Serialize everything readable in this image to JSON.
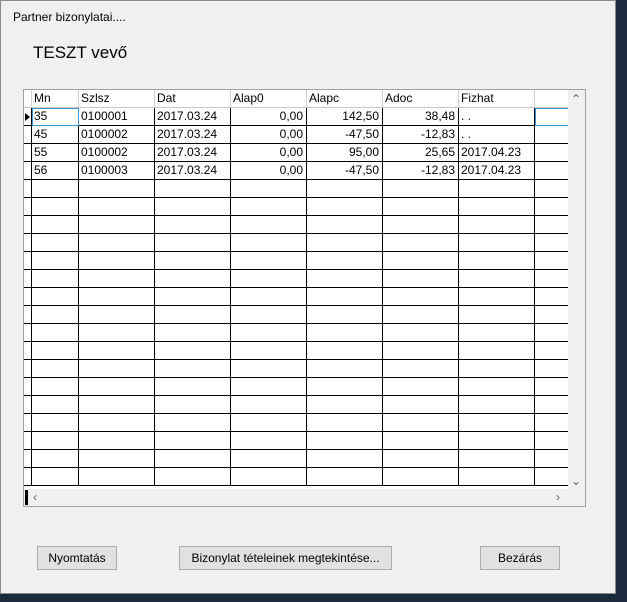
{
  "window": {
    "title": "Partner bizonylatai...."
  },
  "heading": "TESZT vevő",
  "grid": {
    "columns": [
      "Mn",
      "Szlsz",
      "Dat",
      "Alap0",
      "Alapc",
      "Adoc",
      "Fizhat"
    ],
    "rows": [
      {
        "Mn": "35",
        "Szlsz": "0100001",
        "Dat": "2017.03.24",
        "Alap0": "0,00",
        "Alapc": "142,50",
        "Adoc": "38,48",
        "Fizhat": ". ."
      },
      {
        "Mn": "45",
        "Szlsz": "0100002",
        "Dat": "2017.03.24",
        "Alap0": "0,00",
        "Alapc": "-47,50",
        "Adoc": "-12,83",
        "Fizhat": ". ."
      },
      {
        "Mn": "55",
        "Szlsz": "0100002",
        "Dat": "2017.03.24",
        "Alap0": "0,00",
        "Alapc": "95,00",
        "Adoc": "25,65",
        "Fizhat": "2017.04.23"
      },
      {
        "Mn": "56",
        "Szlsz": "0100003",
        "Dat": "2017.03.24",
        "Alap0": "0,00",
        "Alapc": "-47,50",
        "Adoc": "-12,83",
        "Fizhat": "2017.04.23"
      }
    ],
    "current_row": 0,
    "icons": {
      "up": "scroll-up-icon",
      "down": "scroll-down-icon",
      "left": "scroll-left-icon",
      "right": "scroll-right-icon"
    }
  },
  "buttons": {
    "print": "Nyomtatás",
    "view_items": "Bizonylat tételeinek megtekintése...",
    "close": "Bezárás"
  },
  "colors": {
    "selection": "#3a9ad9",
    "button_face": "#e1e1e1",
    "window_bg": "#f0f0f0"
  }
}
